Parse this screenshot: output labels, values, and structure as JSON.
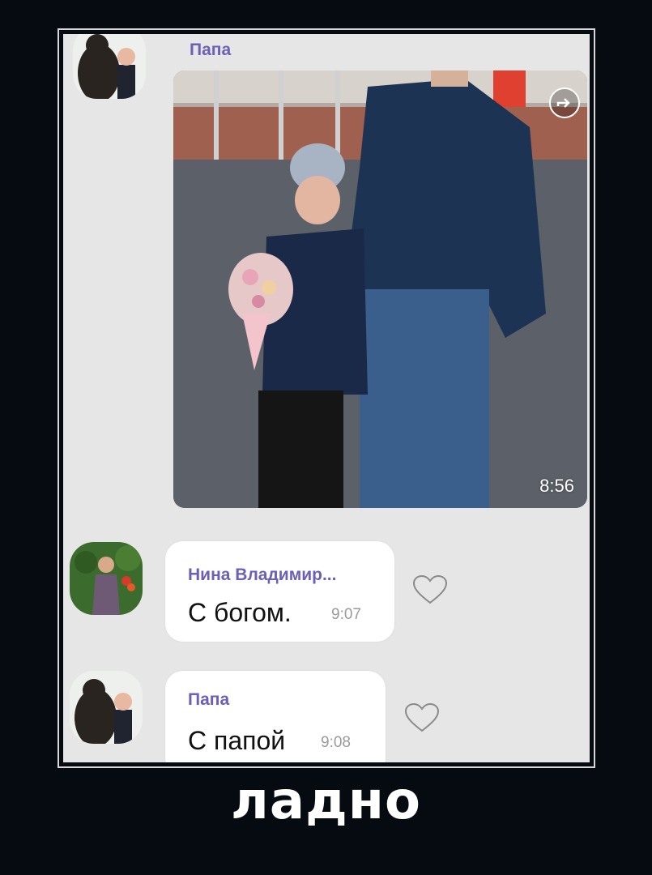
{
  "caption": "ладно",
  "messages": [
    {
      "sender": "Папа",
      "type": "photo",
      "time": "8:56",
      "avatar_icon": "bear-and-boy-avatar",
      "share_icon": "share-icon"
    },
    {
      "sender": "Нина Владимир...",
      "type": "text",
      "text": "С богом.",
      "time": "9:07",
      "avatar_icon": "woman-flowers-avatar",
      "reaction_icon": "heart-outline-icon"
    },
    {
      "sender": "Папа",
      "type": "text",
      "text": "С папой",
      "time": "9:08",
      "avatar_icon": "bear-and-boy-avatar",
      "reaction_icon": "heart-outline-icon"
    }
  ],
  "colors": {
    "background": "#060b12",
    "chat_background": "#e6e6e6",
    "sender_name": "#6b5fb8",
    "bubble": "#ffffff"
  }
}
